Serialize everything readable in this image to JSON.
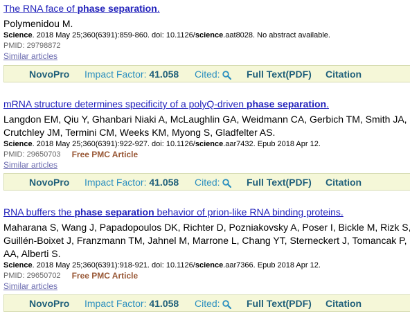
{
  "articles": [
    {
      "title_pre": "The RNA face of ",
      "title_bold": "phase separation",
      "title_post": ".",
      "authors": "Polymenidou M.",
      "journal": "Science",
      "citation_pre": ". 2018 May 25;360(6391):859-860. doi: 10.1126/",
      "citation_bold": "science",
      "citation_post": ".aat8028. No abstract available.",
      "pmid": "PMID: 29798872",
      "free_pmc": "",
      "similar": "Similar articles"
    },
    {
      "title_pre": "mRNA structure determines specificity of a polyQ-driven ",
      "title_bold": "phase separation",
      "title_post": ".",
      "authors": "Langdon EM, Qiu Y, Ghanbari Niaki A, McLaughlin GA, Weidmann CA, Gerbich TM, Smith JA, Crutchley JM, Termini CM, Weeks KM, Myong S, Gladfelter AS.",
      "journal": "Science",
      "citation_pre": ". 2018 May 25;360(6391):922-927. doi: 10.1126/",
      "citation_bold": "science",
      "citation_post": ".aar7432. Epub 2018 Apr 12.",
      "pmid": "PMID: 29650703",
      "free_pmc": "Free PMC Article",
      "similar": "Similar articles"
    },
    {
      "title_pre": "RNA buffers the ",
      "title_bold": "phase separation",
      "title_post": " behavior of prion-like RNA binding proteins.",
      "authors": "Maharana S, Wang J, Papadopoulos DK, Richter D, Pozniakovsky A, Poser I, Bickle M, Rizk S, Guillén-Boixet J, Franzmann TM, Jahnel M, Marrone L, Chang YT, Sterneckert J, Tomancak P, AA, Alberti S.",
      "journal": "Science",
      "citation_pre": ". 2018 May 25;360(6391):918-921. doi: 10.1126/",
      "citation_bold": "science",
      "citation_post": ".aar7366. Epub 2018 Apr 12.",
      "pmid": "PMID: 29650702",
      "free_pmc": "Free PMC Article",
      "similar": "Similar articles"
    }
  ],
  "toolbar": {
    "novopro": "NovoPro",
    "impact_label": "Impact Factor:",
    "impact_value": "41.058",
    "cited": "Cited:",
    "full_text": "Full Text(PDF)",
    "citation": "Citation"
  },
  "colors": {
    "title_link": "#2222bb",
    "toolbar_bg": "#f5f7d8",
    "free_pmc": "#985735"
  },
  "icons": {
    "search": "magnifier-icon"
  }
}
